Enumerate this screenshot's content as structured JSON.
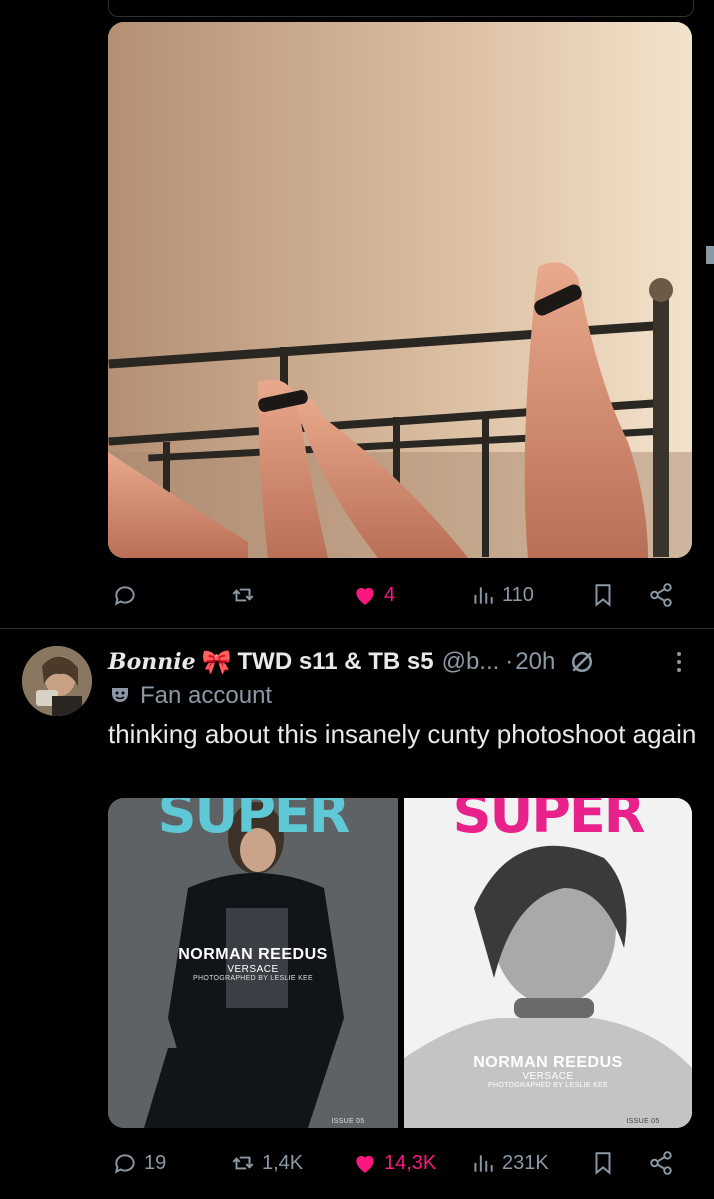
{
  "first_post": {
    "actions": {
      "replies": "",
      "reposts": "",
      "likes": "4",
      "views": "110"
    }
  },
  "second_post": {
    "author": {
      "name_script": "Bonnie",
      "name_emoji": "🎀",
      "name_rest": "TWD s11 & TB s5",
      "handle": "@b...",
      "separator": "·",
      "time": "20h"
    },
    "label": "Fan account",
    "text": "thinking about this insanely cunty photoshoot again",
    "media": [
      {
        "magazine": "SUPER",
        "headline": "NORMAN REEDUS",
        "brand": "VERSACE",
        "credit": "PHOTOGRAPHED BY LESLIE KEE",
        "issue": "ISSUE 05"
      },
      {
        "magazine": "SUPER",
        "headline": "NORMAN REEDUS",
        "brand": "VERSACE",
        "credit": "PHOTOGRAPHED BY LESLIE KEE",
        "issue": "ISSUE 05"
      }
    ],
    "actions": {
      "replies": "19",
      "reposts": "1,4K",
      "likes": "14,3K",
      "views": "231K"
    }
  },
  "colors": {
    "background": "#000000",
    "muted": "#8b98a5",
    "like_pink": "#f91880",
    "text": "#e7e9ea",
    "cover_teal": "#5fc8d6",
    "cover_magenta": "#e8228a"
  }
}
